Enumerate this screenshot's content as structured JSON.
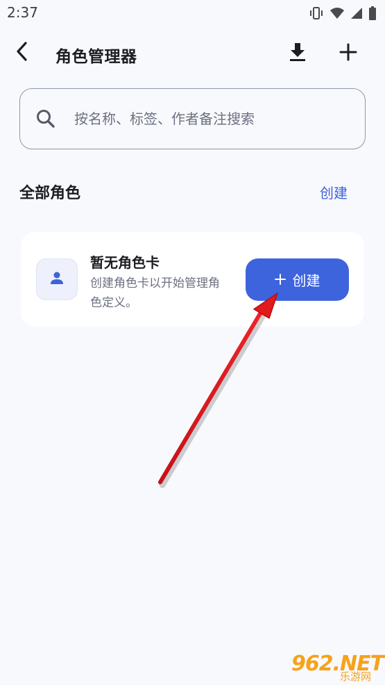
{
  "status_bar": {
    "time": "2:37",
    "icons": [
      "vibrate-icon",
      "wifi-icon",
      "signal-icon",
      "battery-icon"
    ]
  },
  "app_bar": {
    "back_icon": "chevron-left-icon",
    "title": "角色管理器",
    "import_icon": "download-icon",
    "add_icon": "plus-icon"
  },
  "search": {
    "icon": "search-icon",
    "value": "",
    "placeholder": "按名称、标签、作者备注搜索"
  },
  "section": {
    "title": "全部角色",
    "create_label": "创建"
  },
  "empty_state": {
    "avatar_icon": "person-icon",
    "title": "暂无角色卡",
    "description": "创建角色卡以开始管理角色定义。",
    "create_button": {
      "icon": "plus-icon",
      "label": "创建"
    }
  },
  "annotation": {
    "arrow_color": "#e3191c"
  },
  "watermark": {
    "text": "962.NET",
    "subtext": "乐游网"
  },
  "colors": {
    "accent": "#3d63dd",
    "background": "#f8f9fd",
    "card": "#ffffff"
  }
}
